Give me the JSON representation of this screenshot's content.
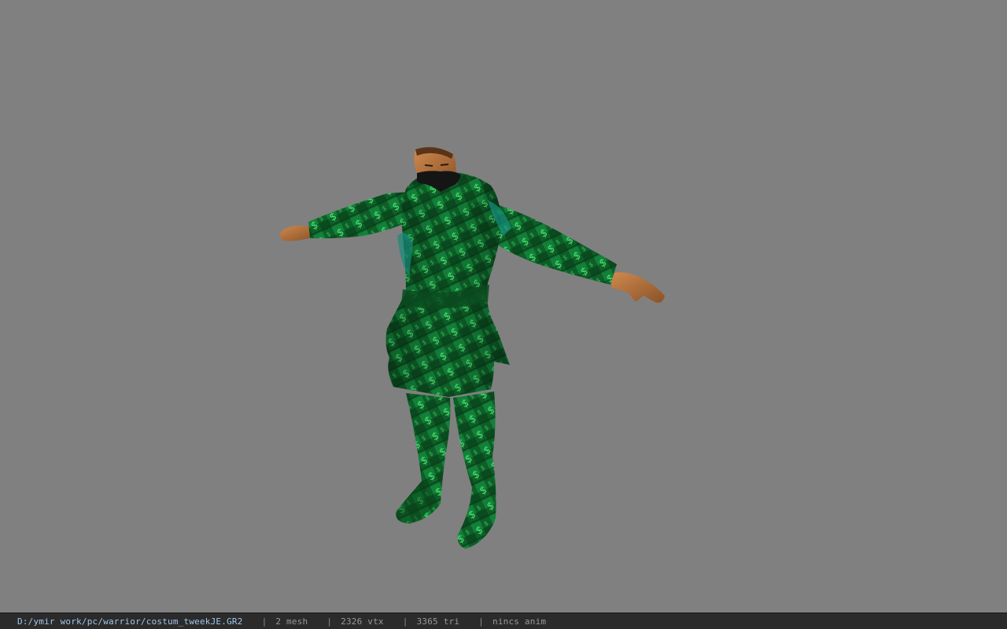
{
  "viewport": {
    "background_color": "#808080",
    "model": {
      "subject": "warrior costume character in T-pose",
      "costume_colors": [
        "#0b5a22",
        "#1f9a3e",
        "#43e067",
        "#178a7a"
      ],
      "skin_color": "#b3723e",
      "mask_color": "#151515"
    }
  },
  "status_bar": {
    "background_color": "#2b2b2b",
    "file_path": "D:/ymir work/pc/warrior/costum_tweekJE.GR2",
    "separator": "|",
    "mesh_count": "2 mesh",
    "vertex_count": "2326 vtx",
    "triangle_count": "3365 tri",
    "anim_status": "nincs anim"
  }
}
